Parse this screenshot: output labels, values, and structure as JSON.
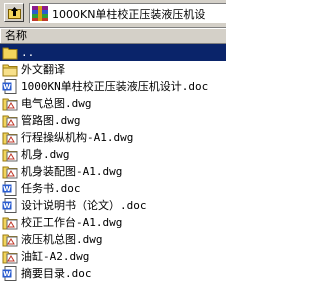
{
  "toolbar": {
    "path_text": "1000KN单柱校正压装液压机设",
    "up_button": "up-folder-icon",
    "archive_icon": "rar-archive-icon"
  },
  "list_header": {
    "name_column": "名称"
  },
  "files": [
    {
      "name": "..",
      "type": "parent",
      "icon": "folder-up-icon",
      "selected": true
    },
    {
      "name": "外文翻译",
      "type": "folder",
      "icon": "folder-icon"
    },
    {
      "name": "1000KN单柱校正压装液压机设计.doc",
      "type": "doc",
      "icon": "doc-icon"
    },
    {
      "name": "电气总图.dwg",
      "type": "dwg",
      "icon": "dwg-icon"
    },
    {
      "name": "管路图.dwg",
      "type": "dwg",
      "icon": "dwg-icon"
    },
    {
      "name": "行程操纵机构-A1.dwg",
      "type": "dwg",
      "icon": "dwg-icon"
    },
    {
      "name": "机身.dwg",
      "type": "dwg",
      "icon": "dwg-icon"
    },
    {
      "name": "机身装配图-A1.dwg",
      "type": "dwg",
      "icon": "dwg-icon"
    },
    {
      "name": "任务书.doc",
      "type": "doc",
      "icon": "doc-icon"
    },
    {
      "name": "设计说明书（论文）.doc",
      "type": "doc",
      "icon": "doc-icon"
    },
    {
      "name": "校正工作台-A1.dwg",
      "type": "dwg",
      "icon": "dwg-icon"
    },
    {
      "name": "液压机总图.dwg",
      "type": "dwg",
      "icon": "dwg-icon"
    },
    {
      "name": "油缸-A2.dwg",
      "type": "dwg",
      "icon": "dwg-icon"
    },
    {
      "name": "摘要目录.doc",
      "type": "doc",
      "icon": "doc-icon"
    }
  ],
  "colors": {
    "selection": "#0a246a",
    "chrome": "#d4d0c8",
    "folder": "#f2d55c",
    "doc_blue": "#2a5ccf"
  }
}
